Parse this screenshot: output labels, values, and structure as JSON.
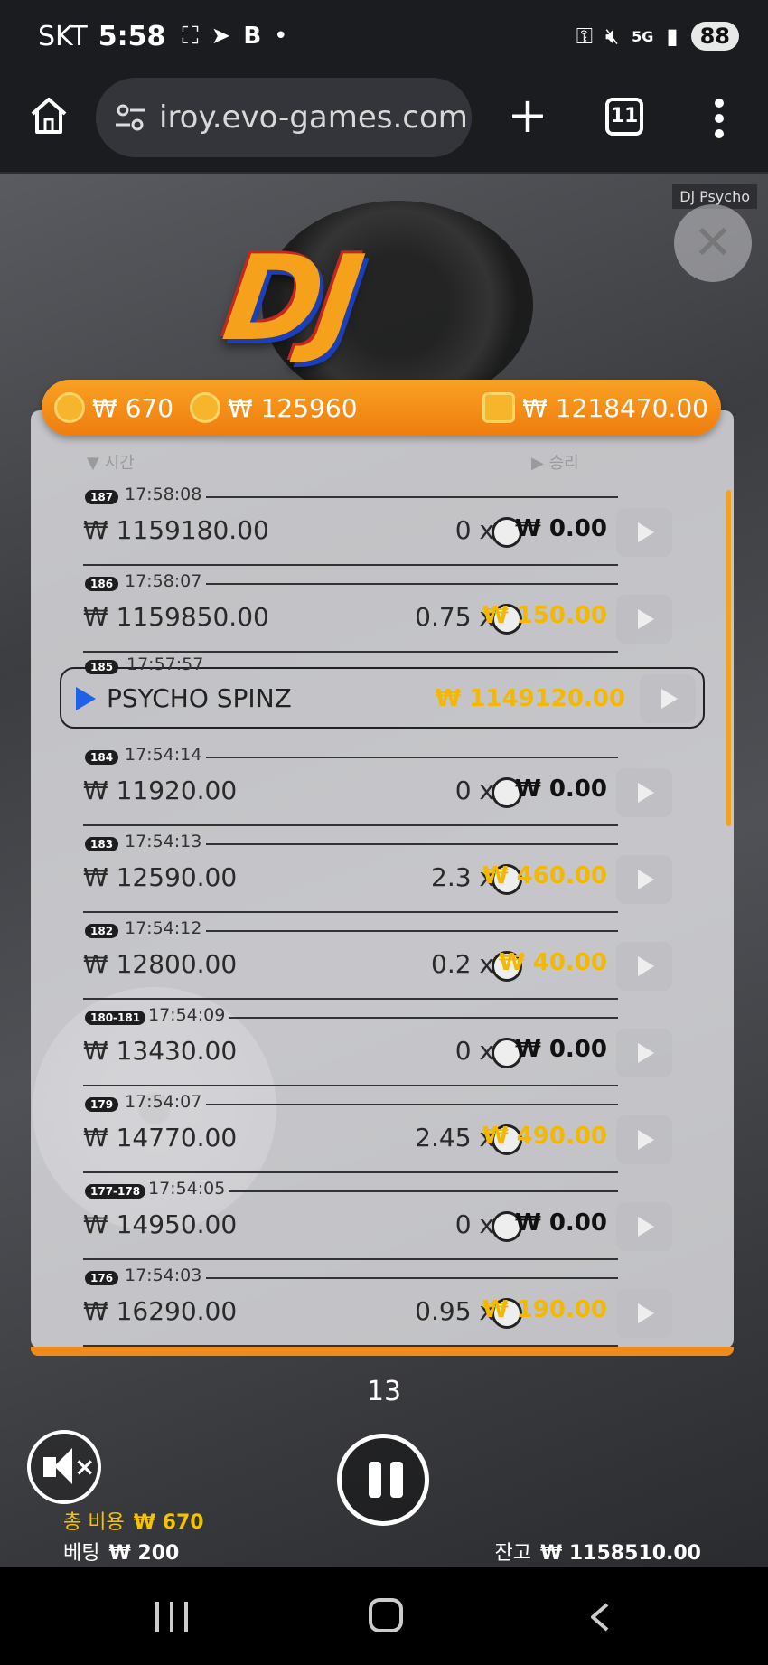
{
  "status_bar": {
    "carrier": "SKT",
    "time": "5:58",
    "battery": "88",
    "network": "5G"
  },
  "browser": {
    "url": "iroy.evo-games.com",
    "tab_count": "11"
  },
  "game": {
    "title_tag": "Dj Psycho",
    "logo_text": "DJ",
    "top_bar": {
      "cost": "₩ 670",
      "bet_total": "₩ 125960",
      "balance": "₩ 1218470.00"
    },
    "columns": {
      "time": "▼ 시간",
      "win": "▶ 승리"
    },
    "history": [
      {
        "idx": "187",
        "time": "17:58:08",
        "balance": "₩ 1159180.00",
        "mult": "0 x",
        "win": "₩ 0.00",
        "gold": false
      },
      {
        "idx": "186",
        "time": "17:58:07",
        "balance": "₩ 1159850.00",
        "mult": "0.75 x",
        "win": "₩ 150.00",
        "gold": true
      },
      {
        "idx": "184",
        "time": "17:54:14",
        "balance": "₩ 11920.00",
        "mult": "0 x",
        "win": "₩ 0.00",
        "gold": false
      },
      {
        "idx": "183",
        "time": "17:54:13",
        "balance": "₩ 12590.00",
        "mult": "2.3 x",
        "win": "₩ 460.00",
        "gold": true
      },
      {
        "idx": "182",
        "time": "17:54:12",
        "balance": "₩ 12800.00",
        "mult": "0.2 x",
        "win": "₩ 40.00",
        "gold": true
      },
      {
        "idx": "180-181",
        "time": "17:54:09",
        "balance": "₩ 13430.00",
        "mult": "0 x",
        "win": "₩ 0.00",
        "gold": false
      },
      {
        "idx": "179",
        "time": "17:54:07",
        "balance": "₩ 14770.00",
        "mult": "2.45 x",
        "win": "₩ 490.00",
        "gold": true
      },
      {
        "idx": "177-178",
        "time": "17:54:05",
        "balance": "₩ 14950.00",
        "mult": "0 x",
        "win": "₩ 0.00",
        "gold": false
      },
      {
        "idx": "176",
        "time": "17:54:03",
        "balance": "₩ 16290.00",
        "mult": "0.95 x",
        "win": "₩ 190.00",
        "gold": true
      }
    ],
    "feature_row": {
      "idx": "185",
      "time": "17:57:57",
      "label": "PSYCHO SPINZ",
      "win": "₩ 1149120.00"
    },
    "autoplay_count": "13",
    "footer": {
      "total_cost_label": "총 비용",
      "total_cost": "₩ 670",
      "bet_label": "베팅",
      "bet": "₩ 200",
      "balance_label": "잔고",
      "balance": "₩ 1158510.00"
    }
  },
  "colors": {
    "accent": "#f08a1a",
    "win_gold": "#f4b800",
    "feature_arrow": "#1e62e8"
  }
}
